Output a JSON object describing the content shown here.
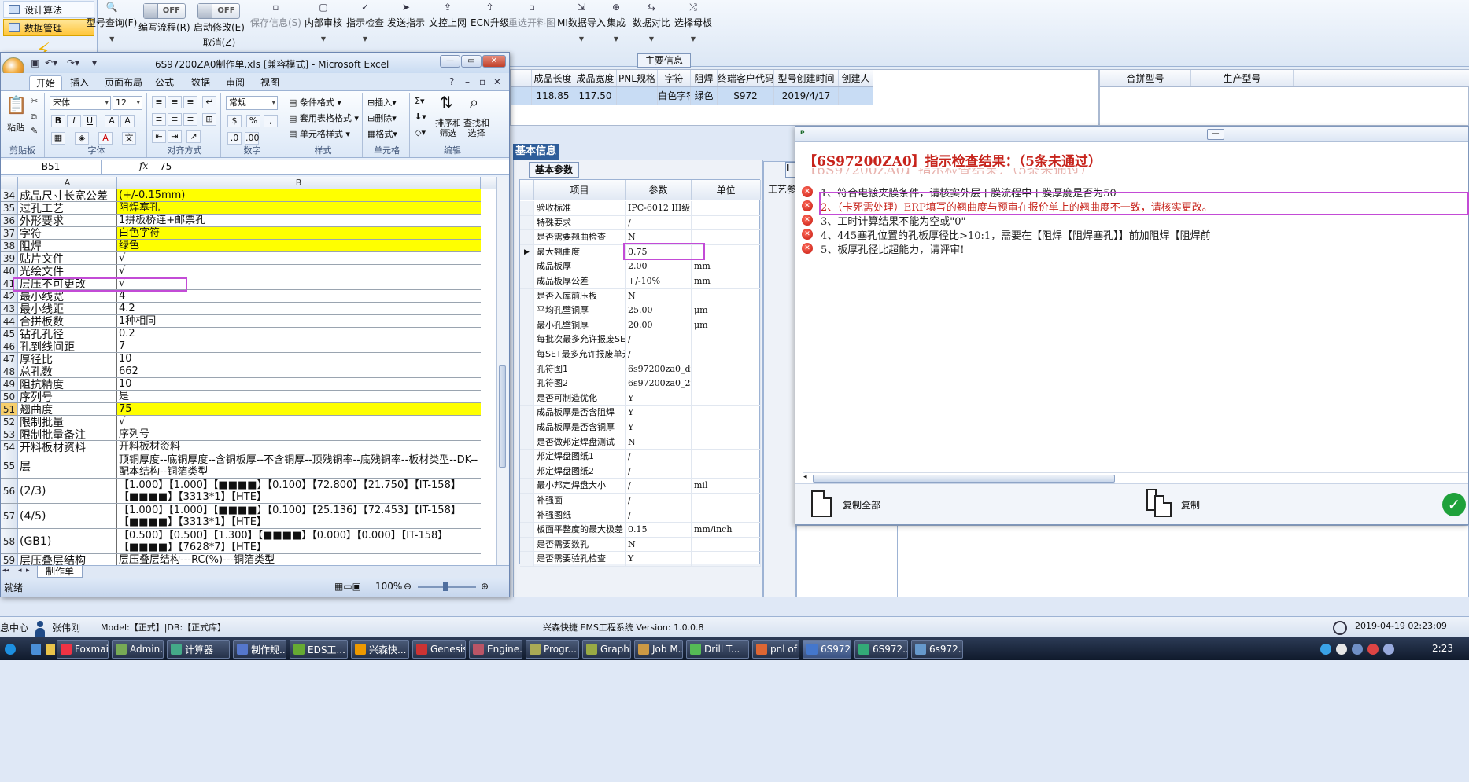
{
  "nav": {
    "items": [
      {
        "label": "设计算法",
        "active": false
      },
      {
        "label": "数据管理",
        "active": true
      }
    ]
  },
  "toolbar": {
    "model_query": "型号查询(F)",
    "write_flow_toggle": "OFF",
    "write_flow": "编写流程(R)",
    "start_modify_toggle": "OFF",
    "start_modify": "启动修改(E)",
    "cancel": "取消(Z)",
    "save_info": "保存信息(S)",
    "internal_review": "内部审核",
    "indicator_check": "指示检查",
    "send_indicator": "发送指示",
    "upload_doc": "文控上网",
    "ecn_upgrade": "ECN升级",
    "resend_drawing": "重选开料图",
    "mi_import": "MI数据导入",
    "integrate": "集成",
    "data_compare": "数据对比",
    "select_master": "选择母板"
  },
  "main_info": {
    "tab": "主要信息",
    "columns": [
      "成品长度",
      "成品宽度",
      "PNL规格",
      "字符",
      "阻焊",
      "终端客户代码",
      "型号创建时间",
      "创建人"
    ],
    "row": [
      "118.85",
      "117.50",
      "",
      "白色字符",
      "绿色",
      "S972",
      "2019/4/17",
      ""
    ],
    "right_columns": [
      "合拼型号",
      "生产型号"
    ]
  },
  "basic_info": {
    "title": "基本信息",
    "tab": "基本参数",
    "third_tab": "I",
    "craft_label": "工艺参",
    "columns": [
      "项目",
      "参数",
      "单位"
    ],
    "rows": [
      {
        "item": "验收标准",
        "value": "IPC-6012 III级",
        "unit": ""
      },
      {
        "item": "特殊要求",
        "value": "/",
        "unit": ""
      },
      {
        "item": "是否需要翘曲检查",
        "value": "N",
        "unit": ""
      },
      {
        "item": "最大翘曲度",
        "value": "0.75",
        "unit": "",
        "current": true
      },
      {
        "item": "成品板厚",
        "value": "2.00",
        "unit": "mm"
      },
      {
        "item": "成品板厚公差",
        "value": "+/-10%",
        "unit": "mm"
      },
      {
        "item": "是否入库前压板",
        "value": "N",
        "unit": ""
      },
      {
        "item": "平均孔壁铜厚",
        "value": "25.00",
        "unit": "μm"
      },
      {
        "item": "最小孔壁铜厚",
        "value": "20.00",
        "unit": "μm"
      },
      {
        "item": "每批次最多允许报废SET",
        "value": "/",
        "unit": ""
      },
      {
        "item": "每SET最多允许报废单元",
        "value": "/",
        "unit": ""
      },
      {
        "item": "孔符图1",
        "value": "6s97200za0_dr...",
        "unit": ""
      },
      {
        "item": "孔符图2",
        "value": "6s97200za0_2r...",
        "unit": ""
      },
      {
        "item": "是否可制造优化",
        "value": "Y",
        "unit": ""
      },
      {
        "item": "成品板厚是否含阻焊",
        "value": "Y",
        "unit": ""
      },
      {
        "item": "成品板厚是否含铜厚",
        "value": "Y",
        "unit": ""
      },
      {
        "item": "是否做邦定焊盘测试",
        "value": "N",
        "unit": ""
      },
      {
        "item": "邦定焊盘图纸1",
        "value": "/",
        "unit": ""
      },
      {
        "item": "邦定焊盘图纸2",
        "value": "/",
        "unit": ""
      },
      {
        "item": "最小邦定焊盘大小",
        "value": "/",
        "unit": "mil"
      },
      {
        "item": "补强面",
        "value": "/",
        "unit": ""
      },
      {
        "item": "补强图纸",
        "value": "/",
        "unit": ""
      },
      {
        "item": "板面平整度的最大极差",
        "value": "0.15",
        "unit": "mm/inch"
      },
      {
        "item": "是否需要数孔",
        "value": "N",
        "unit": ""
      },
      {
        "item": "是否需要验孔检查",
        "value": "Y",
        "unit": ""
      }
    ]
  },
  "excel": {
    "title": "6S97200ZA0制作单.xls  [兼容模式] - Microsoft Excel",
    "tabs": [
      "开始",
      "插入",
      "页面布局",
      "公式",
      "数据",
      "审阅",
      "视图"
    ],
    "ribbon": {
      "paste": "粘贴",
      "clipboard": "剪贴板",
      "font_name": "宋体",
      "font_size": "12",
      "font_group": "字体",
      "align_group": "对齐方式",
      "number_format": "常规",
      "number_group": "数字",
      "cond_format": "条件格式",
      "table_format": "套用表格格式",
      "cell_style": "单元格样式",
      "style_group": "样式",
      "insert": "插入",
      "delete": "删除",
      "format": "格式",
      "cells_group": "单元格",
      "sort_filter": "排序和\n筛选",
      "find_select": "查找和\n选择",
      "edit_group": "编辑"
    },
    "name_box": "B51",
    "fx": "fx",
    "formula": "75",
    "col_headers": [
      "A",
      "B"
    ],
    "rows": [
      {
        "n": "34",
        "a": "成品尺寸长宽公差",
        "b": "(+/-0.15mm)",
        "y": true
      },
      {
        "n": "35",
        "a": "过孔工艺",
        "b": "阻焊塞孔",
        "y": true
      },
      {
        "n": "36",
        "a": "外形要求",
        "b": "1拼板桥连+邮票孔",
        "y": false
      },
      {
        "n": "37",
        "a": "字符",
        "b": "白色字符",
        "y": true
      },
      {
        "n": "38",
        "a": "阻焊",
        "b": "绿色",
        "y": true
      },
      {
        "n": "39",
        "a": "贴片文件",
        "b": "√",
        "y": false
      },
      {
        "n": "40",
        "a": "光绘文件",
        "b": "√",
        "y": false
      },
      {
        "n": "41",
        "a": "层压不可更改",
        "b": "√",
        "y": false
      },
      {
        "n": "42",
        "a": "最小线宽",
        "b": "4",
        "y": false
      },
      {
        "n": "43",
        "a": "最小线距",
        "b": "4.2",
        "y": false
      },
      {
        "n": "44",
        "a": "合拼板数",
        "b": "1种相同",
        "y": false
      },
      {
        "n": "45",
        "a": "钻孔孔径",
        "b": "0.2",
        "y": false
      },
      {
        "n": "46",
        "a": "孔到线间距",
        "b": "7",
        "y": false
      },
      {
        "n": "47",
        "a": "厚径比",
        "b": "10",
        "y": false
      },
      {
        "n": "48",
        "a": "总孔数",
        "b": "662",
        "y": false
      },
      {
        "n": "49",
        "a": "阻抗精度",
        "b": "10",
        "y": false
      },
      {
        "n": "50",
        "a": "序列号",
        "b": "是",
        "y": false
      },
      {
        "n": "51",
        "a": "翘曲度",
        "b": "75",
        "y": true
      },
      {
        "n": "52",
        "a": "限制批量",
        "b": "√",
        "y": false
      },
      {
        "n": "53",
        "a": "限制批量备注",
        "b": "序列号",
        "y": false
      },
      {
        "n": "54",
        "a": "开料板材资料",
        "b": "开料板材资料",
        "y": false
      },
      {
        "n": "55",
        "a": "层",
        "b": "顶铜厚度--底铜厚度--含铜板厚--不含铜厚--顶残铜率--底残铜率--板材类型--DK--配本结构--铜箔类型",
        "y": false
      },
      {
        "n": "56",
        "a": "(2/3)",
        "b": "【1.000】【1.000】【■■■■】【0.100】【72.800】【21.750】【IT-158】【■■■■】【3313*1】【HTE】",
        "y": false
      },
      {
        "n": "57",
        "a": "(4/5)",
        "b": "【1.000】【1.000】【■■■■】【0.100】【25.136】【72.453】【IT-158】【■■■■】【3313*1】【HTE】",
        "y": false
      },
      {
        "n": "58",
        "a": "(GB1)",
        "b": "【0.500】【0.500】【1.300】【■■■■】【0.000】【0.000】【IT-158】【■■■■】【7628*7】【HTE】",
        "y": false
      },
      {
        "n": "59",
        "a": "层压叠层结构",
        "b": "层压叠层结构---RC(%)---铜箔类型",
        "y": false
      }
    ],
    "sheet_tab": "制作单",
    "status_ready": "就绪",
    "zoom": "100%"
  },
  "dialog": {
    "heading": "【6S97200ZA0】指示检查结果：（5条未通过）",
    "ghost": "【6S97200ZA0】指示检查结果：（5条未通过）",
    "messages": [
      {
        "text": "1、符合电镀夹膜条件，请核实外层干膜流程中干膜厚度是否为50",
        "red": false
      },
      {
        "text": "2、（卡死需处理）ERP填写的翘曲度与预审在报价单上的翘曲度不一致，请核实更改。",
        "red": true
      },
      {
        "text": "3、工时计算结果不能为空或\"0\"",
        "red": false
      },
      {
        "text": "4、445塞孔位置的孔板厚径比>10:1，需要在【阻焊【阻焊塞孔】】前加阻焊【阻焊前",
        "red": false
      },
      {
        "text": "5、板厚孔径比超能力，请评审!",
        "red": false
      }
    ],
    "copy_all": "复制全部",
    "copy": "复制"
  },
  "status": {
    "info_center": "息中心",
    "user": "张伟刚",
    "model": "Model:【正式】|DB:【正式库】",
    "app_version": "兴森快捷 EMS工程系统 Version: 1.0.0.8",
    "datetime": "2019-04-19 02:23:09"
  },
  "taskbar": {
    "tasks": [
      "Foxmail",
      "Admin...",
      "计算器",
      "制作规...",
      "EDS工...",
      "兴森快...",
      "Genesis",
      "Engine...",
      "Progr...",
      "Graphi...",
      "Job M...",
      "Drill T...",
      "pnl of ...",
      "6S972...",
      "6S972...",
      "6s972..."
    ],
    "time": "2:23"
  }
}
